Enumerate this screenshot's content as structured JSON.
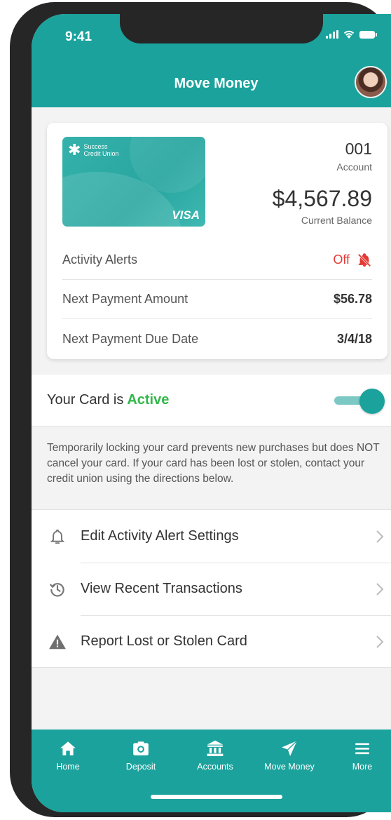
{
  "status_bar": {
    "time": "9:41"
  },
  "header": {
    "title": "Move Money"
  },
  "card": {
    "brand_line1": "Success",
    "brand_line2": "Credit Union",
    "network": "VISA",
    "account_number": "001",
    "account_label": "Account",
    "balance": "$4,567.89",
    "balance_label": "Current Balance"
  },
  "details": [
    {
      "label": "Activity Alerts",
      "value": "Off"
    },
    {
      "label": "Next Payment Amount",
      "value": "$56.78"
    },
    {
      "label": "Next Payment Due Date",
      "value": "3/4/18"
    }
  ],
  "card_status": {
    "prefix": "Your Card is",
    "state": "Active",
    "toggle_on": true
  },
  "info_text": "Temporarily locking your card prevents new purchases but does NOT cancel your card. If your card has been lost or stolen, contact your credit union using the directions below.",
  "menu": [
    {
      "label": "Edit Activity Alert Settings",
      "icon": "bell-icon"
    },
    {
      "label": "View Recent Transactions",
      "icon": "history-icon"
    },
    {
      "label": "Report Lost or Stolen Card",
      "icon": "warning-icon"
    }
  ],
  "nav": [
    {
      "label": "Home",
      "icon": "home-icon"
    },
    {
      "label": "Deposit",
      "icon": "camera-icon"
    },
    {
      "label": "Accounts",
      "icon": "bank-icon"
    },
    {
      "label": "Move Money",
      "icon": "send-icon"
    },
    {
      "label": "More",
      "icon": "menu-icon"
    }
  ],
  "colors": {
    "brand": "#1ba29c",
    "active": "#32b84a",
    "alert_off": "#e53935"
  }
}
